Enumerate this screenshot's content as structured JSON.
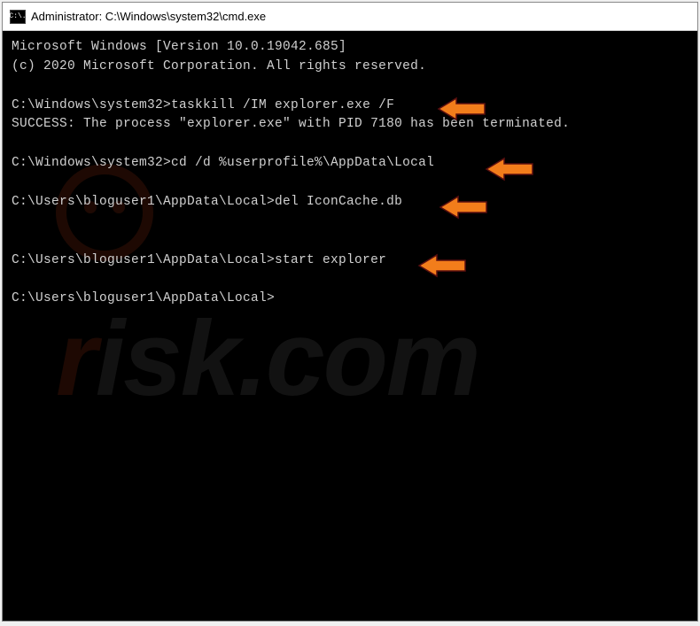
{
  "window": {
    "icon_label": "C:\\.",
    "title": "Administrator: C:\\Windows\\system32\\cmd.exe"
  },
  "terminal": {
    "line1": "Microsoft Windows [Version 10.0.19042.685]",
    "line2": "(c) 2020 Microsoft Corporation. All rights reserved.",
    "prompt1": "C:\\Windows\\system32>",
    "cmd1": "taskkill /IM explorer.exe /F",
    "out1": "SUCCESS: The process \"explorer.exe\" with PID 7180 has been terminated.",
    "prompt2": "C:\\Windows\\system32>",
    "cmd2": "cd /d %userprofile%\\AppData\\Local",
    "prompt3": "C:\\Users\\bloguser1\\AppData\\Local>",
    "cmd3": "del IconCache.db",
    "prompt4": "C:\\Users\\bloguser1\\AppData\\Local>",
    "cmd4": "start explorer",
    "prompt5": "C:\\Users\\bloguser1\\AppData\\Local>"
  },
  "annotations": {
    "arrow_color_fill": "#f27d1b",
    "arrow_color_stroke": "#5a0f0f",
    "arrows": [
      {
        "name": "arrow-taskkill"
      },
      {
        "name": "arrow-cd"
      },
      {
        "name": "arrow-del"
      },
      {
        "name": "arrow-start"
      }
    ]
  },
  "watermark": {
    "text_part1": "r",
    "text_part2": "isk.com"
  }
}
